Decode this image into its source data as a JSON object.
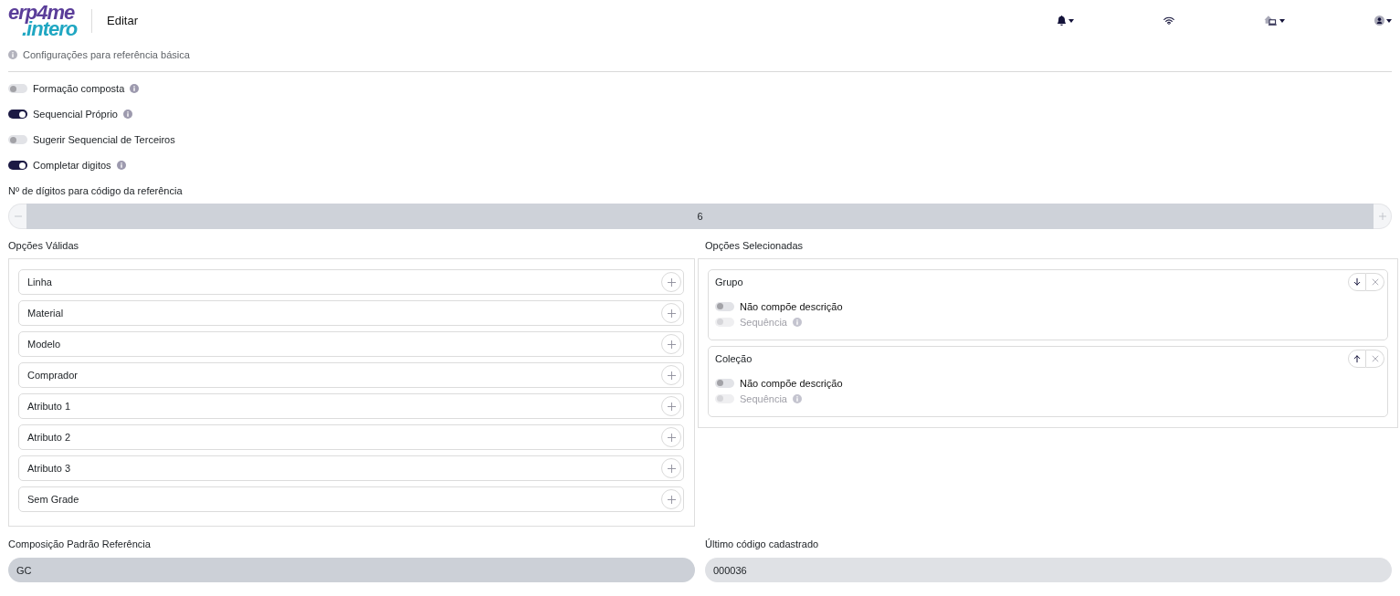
{
  "header": {
    "logo": {
      "line_1": "erp4me",
      "line_2": ".intero"
    },
    "title": "Editar",
    "actions": [
      {
        "kind": "bell",
        "caret": true
      },
      {
        "kind": "wifi",
        "caret": false
      },
      {
        "kind": "house-laptop",
        "caret": true
      },
      {
        "kind": "user",
        "caret": true
      }
    ]
  },
  "section": {
    "info_text": "Configurações para referência básica"
  },
  "settings": [
    {
      "label": "Formação composta",
      "on": false,
      "info": true
    },
    {
      "label": "Sequencial Próprio",
      "on": true,
      "info": true
    },
    {
      "label": "Sugerir Sequencial de Terceiros",
      "on": false,
      "info": false
    },
    {
      "label": "Completar digitos",
      "on": true,
      "info": true
    }
  ],
  "digits": {
    "label": "Nº de dígitos para código da referência",
    "value": "6"
  },
  "valid_options": {
    "title": "Opções Válidas",
    "items": [
      "Linha",
      "Material",
      "Modelo",
      "Comprador",
      "Atributo 1",
      "Atributo 2",
      "Atributo 3",
      "Sem Grade"
    ]
  },
  "selected_options": {
    "title": "Opções Selecionadas",
    "items": [
      {
        "name": "Grupo",
        "kind": "move-down",
        "toggles": [
          {
            "label": "Não compõe descrição",
            "on": false,
            "disabled": false,
            "info": false
          },
          {
            "label": "Sequência",
            "on": false,
            "disabled": true,
            "info": true
          }
        ]
      },
      {
        "name": "Coleção",
        "kind": "move-up",
        "toggles": [
          {
            "label": "Não compõe descrição",
            "on": false,
            "disabled": false,
            "info": false
          },
          {
            "label": "Sequência",
            "on": false,
            "disabled": true,
            "info": true
          }
        ]
      }
    ]
  },
  "footer_fields": [
    {
      "label": "Composição Padrão Referência",
      "value": "GC",
      "disabled": true
    },
    {
      "label": "Último código cadastrado",
      "value": "000036",
      "disabled": false
    }
  ]
}
